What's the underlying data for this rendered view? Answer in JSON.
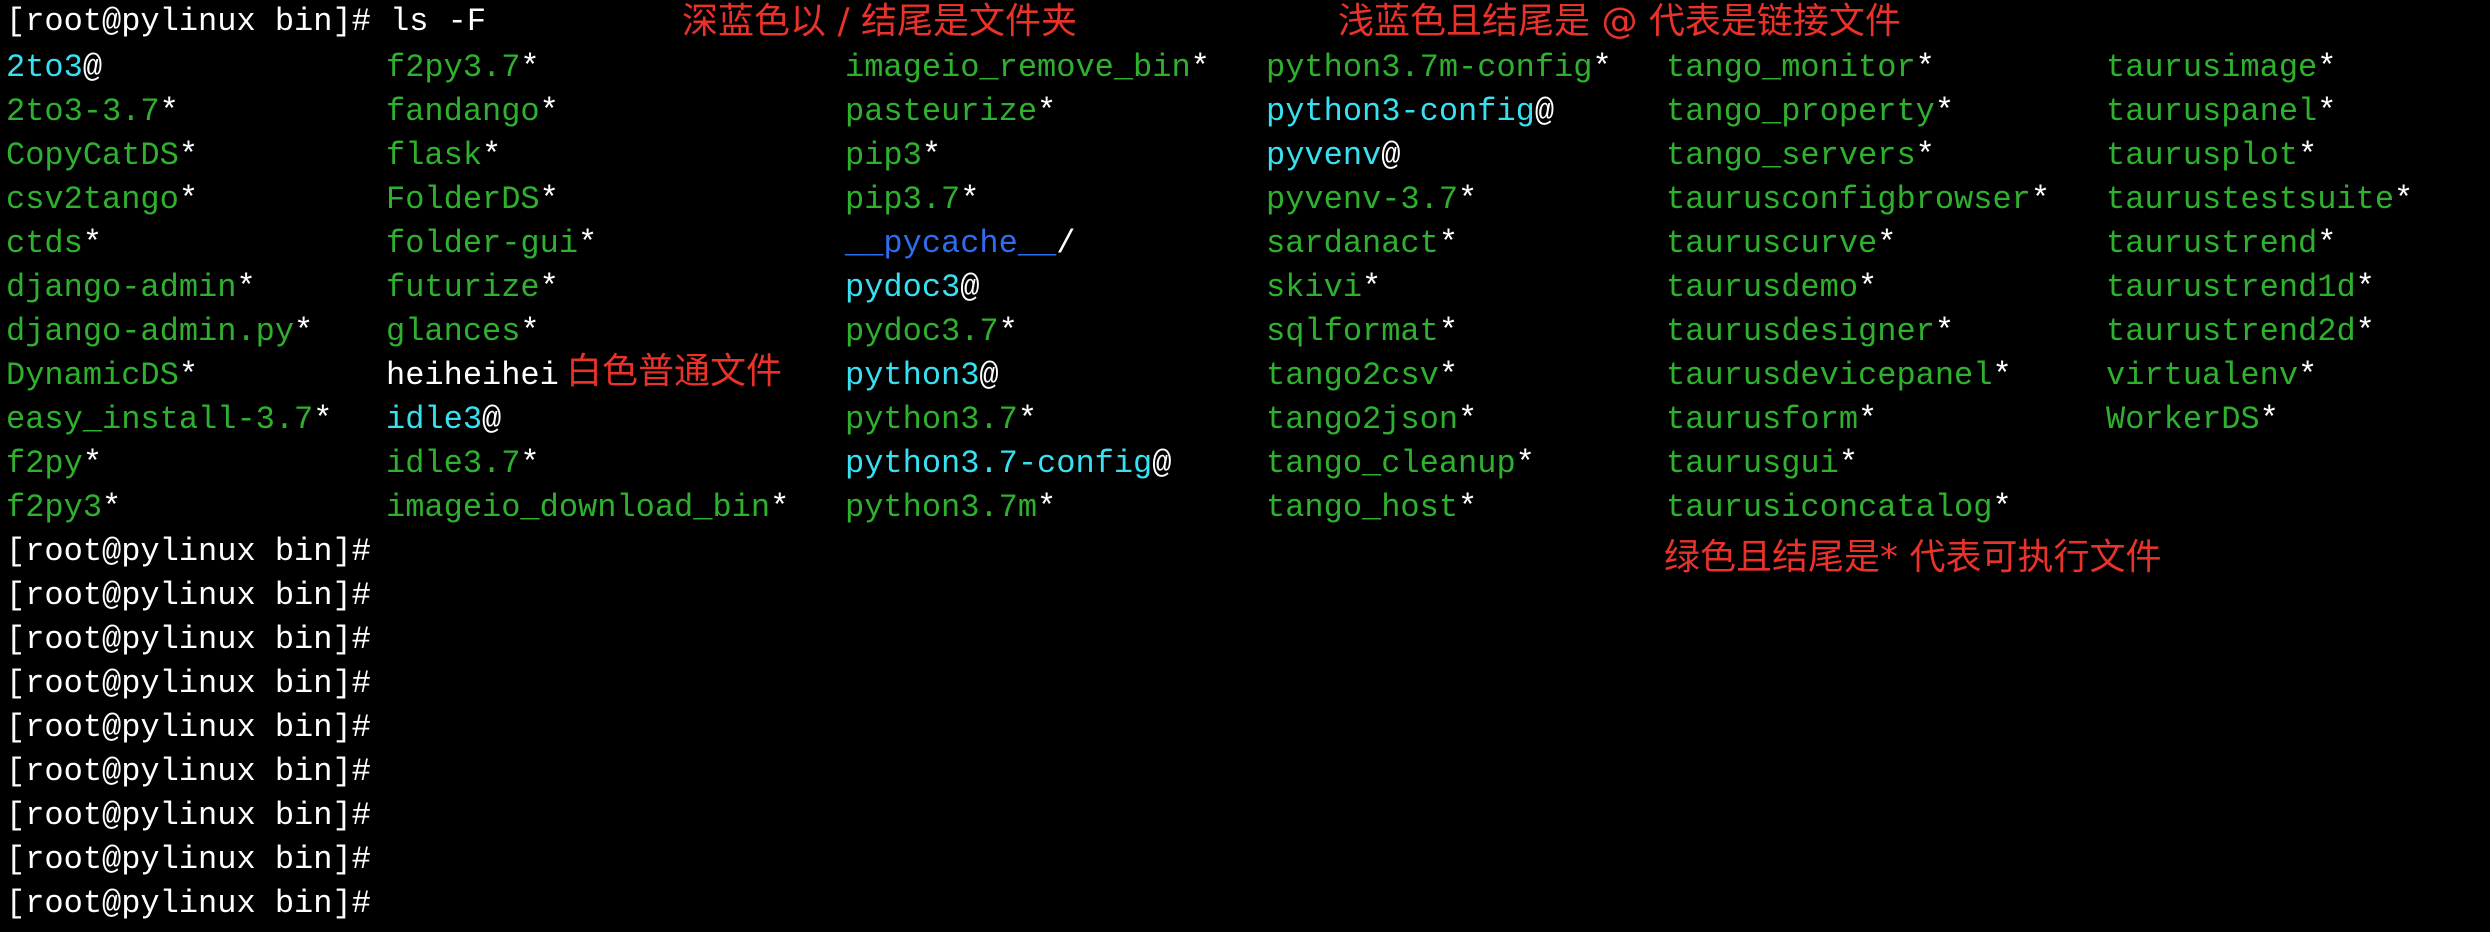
{
  "colors": {
    "background": "#000000",
    "executable": "#2fb12f",
    "link": "#38e0f0",
    "directory": "#2f6cf0",
    "regular": "#ffffff",
    "annotation": "#e8322a"
  },
  "terminal": {
    "command_prompt": "[root@pylinux bin]# ls -F",
    "columns": [
      [
        {
          "name": "2to3",
          "type": "link",
          "suffix": "@"
        },
        {
          "name": "2to3-3.7",
          "type": "executable",
          "suffix": "*"
        },
        {
          "name": "CopyCatDS",
          "type": "executable",
          "suffix": "*"
        },
        {
          "name": "csv2tango",
          "type": "executable",
          "suffix": "*"
        },
        {
          "name": "ctds",
          "type": "executable",
          "suffix": "*"
        },
        {
          "name": "django-admin",
          "type": "executable",
          "suffix": "*"
        },
        {
          "name": "django-admin.py",
          "type": "executable",
          "suffix": "*"
        },
        {
          "name": "DynamicDS",
          "type": "executable",
          "suffix": "*"
        },
        {
          "name": "easy_install-3.7",
          "type": "executable",
          "suffix": "*"
        },
        {
          "name": "f2py",
          "type": "executable",
          "suffix": "*"
        },
        {
          "name": "f2py3",
          "type": "executable",
          "suffix": "*"
        }
      ],
      [
        {
          "name": "f2py3.7",
          "type": "executable",
          "suffix": "*"
        },
        {
          "name": "fandango",
          "type": "executable",
          "suffix": "*"
        },
        {
          "name": "flask",
          "type": "executable",
          "suffix": "*"
        },
        {
          "name": "FolderDS",
          "type": "executable",
          "suffix": "*"
        },
        {
          "name": "folder-gui",
          "type": "executable",
          "suffix": "*"
        },
        {
          "name": "futurize",
          "type": "executable",
          "suffix": "*"
        },
        {
          "name": "glances",
          "type": "executable",
          "suffix": "*"
        },
        {
          "name": "heiheihei",
          "type": "regular",
          "suffix": ""
        },
        {
          "name": "idle3",
          "type": "link",
          "suffix": "@"
        },
        {
          "name": "idle3.7",
          "type": "executable",
          "suffix": "*"
        },
        {
          "name": "imageio_download_bin",
          "type": "executable",
          "suffix": "*"
        }
      ],
      [
        {
          "name": "imageio_remove_bin",
          "type": "executable",
          "suffix": "*"
        },
        {
          "name": "pasteurize",
          "type": "executable",
          "suffix": "*"
        },
        {
          "name": "pip3",
          "type": "executable",
          "suffix": "*"
        },
        {
          "name": "pip3.7",
          "type": "executable",
          "suffix": "*"
        },
        {
          "name": "__pycache__",
          "type": "directory",
          "suffix": "/"
        },
        {
          "name": "pydoc3",
          "type": "link",
          "suffix": "@"
        },
        {
          "name": "pydoc3.7",
          "type": "executable",
          "suffix": "*"
        },
        {
          "name": "python3",
          "type": "link",
          "suffix": "@"
        },
        {
          "name": "python3.7",
          "type": "executable",
          "suffix": "*"
        },
        {
          "name": "python3.7-config",
          "type": "link",
          "suffix": "@"
        },
        {
          "name": "python3.7m",
          "type": "executable",
          "suffix": "*"
        }
      ],
      [
        {
          "name": "python3.7m-config",
          "type": "executable",
          "suffix": "*"
        },
        {
          "name": "python3-config",
          "type": "link",
          "suffix": "@"
        },
        {
          "name": "pyvenv",
          "type": "link",
          "suffix": "@"
        },
        {
          "name": "pyvenv-3.7",
          "type": "executable",
          "suffix": "*"
        },
        {
          "name": "sardanact",
          "type": "executable",
          "suffix": "*"
        },
        {
          "name": "skivi",
          "type": "executable",
          "suffix": "*"
        },
        {
          "name": "sqlformat",
          "type": "executable",
          "suffix": "*"
        },
        {
          "name": "tango2csv",
          "type": "executable",
          "suffix": "*"
        },
        {
          "name": "tango2json",
          "type": "executable",
          "suffix": "*"
        },
        {
          "name": "tango_cleanup",
          "type": "executable",
          "suffix": "*"
        },
        {
          "name": "tango_host",
          "type": "executable",
          "suffix": "*"
        }
      ],
      [
        {
          "name": "tango_monitor",
          "type": "executable",
          "suffix": "*"
        },
        {
          "name": "tango_property",
          "type": "executable",
          "suffix": "*"
        },
        {
          "name": "tango_servers",
          "type": "executable",
          "suffix": "*"
        },
        {
          "name": "taurusconfigbrowser",
          "type": "executable",
          "suffix": "*"
        },
        {
          "name": "tauruscurve",
          "type": "executable",
          "suffix": "*"
        },
        {
          "name": "taurusdemo",
          "type": "executable",
          "suffix": "*"
        },
        {
          "name": "taurusdesigner",
          "type": "executable",
          "suffix": "*"
        },
        {
          "name": "taurusdevicepanel",
          "type": "executable",
          "suffix": "*"
        },
        {
          "name": "taurusform",
          "type": "executable",
          "suffix": "*"
        },
        {
          "name": "taurusgui",
          "type": "executable",
          "suffix": "*"
        },
        {
          "name": "taurusiconcatalog",
          "type": "executable",
          "suffix": "*"
        }
      ],
      [
        {
          "name": "taurusimage",
          "type": "executable",
          "suffix": "*"
        },
        {
          "name": "tauruspanel",
          "type": "executable",
          "suffix": "*"
        },
        {
          "name": "taurusplot",
          "type": "executable",
          "suffix": "*"
        },
        {
          "name": "taurustestsuite",
          "type": "executable",
          "suffix": "*"
        },
        {
          "name": "taurustrend",
          "type": "executable",
          "suffix": "*"
        },
        {
          "name": "taurustrend1d",
          "type": "executable",
          "suffix": "*"
        },
        {
          "name": "taurustrend2d",
          "type": "executable",
          "suffix": "*"
        },
        {
          "name": "virtualenv",
          "type": "executable",
          "suffix": "*"
        },
        {
          "name": "WorkerDS",
          "type": "executable",
          "suffix": "*"
        }
      ]
    ],
    "prompts": [
      "[root@pylinux bin]#",
      "[root@pylinux bin]#",
      "[root@pylinux bin]#",
      "[root@pylinux bin]#",
      "[root@pylinux bin]#",
      "[root@pylinux bin]#",
      "[root@pylinux bin]#",
      "[root@pylinux bin]#",
      "[root@pylinux bin]#"
    ]
  },
  "annotations": {
    "directory_note": "深蓝色以 / 结尾是文件夹",
    "link_note": "浅蓝色且结尾是 @ 代表是链接文件",
    "regular_note": "白色普通文件",
    "executable_note": "绿色且结尾是* 代表可执行文件"
  }
}
